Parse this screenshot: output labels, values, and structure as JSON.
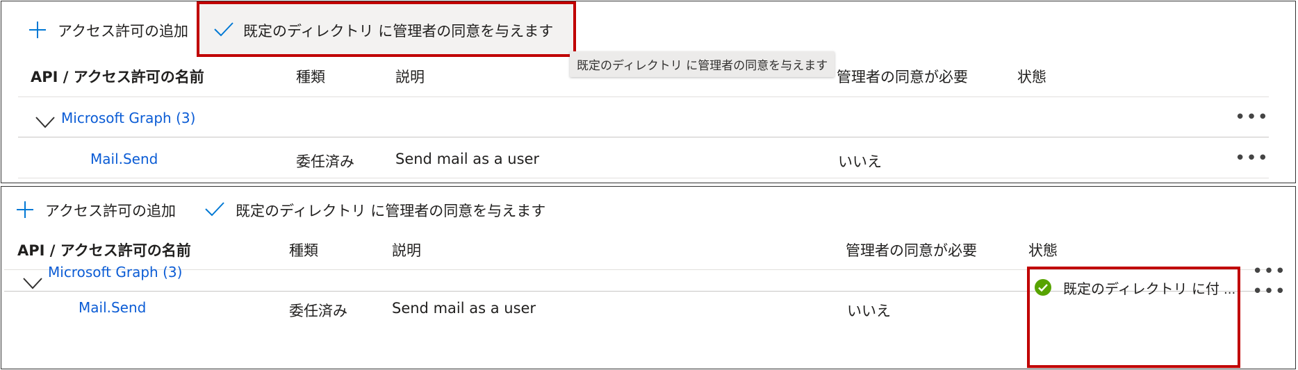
{
  "toolbar": {
    "add_permission_label": "アクセス許可の追加",
    "grant_consent_label": "既定のディレクトリ に管理者の同意を与えます"
  },
  "tooltip": {
    "text": "既定のディレクトリ に管理者の同意を与えます"
  },
  "table": {
    "headers": {
      "api_name": "API / アクセス許可の名前",
      "type": "種類",
      "description": "説明",
      "admin_consent_required": "管理者の同意が必要",
      "status": "状態"
    },
    "header_admin_consent_partial": "管理者の同意が必要",
    "group": {
      "label": "Microsoft Graph (3)"
    },
    "row": {
      "name": "Mail.Send",
      "type": "委任済み",
      "description": "Send mail as a user",
      "admin_consent": "いいえ",
      "status": "既定のディレクトリ に付"
    },
    "more_label": "•••",
    "ellipsis": "..."
  },
  "colors": {
    "highlight_border": "#c00000",
    "link": "#0b5cd5",
    "accent_icon": "#0078d4",
    "success": "#57a300"
  },
  "icons": {
    "add": "plus-icon",
    "consent": "checkmark-icon",
    "expand": "chevron-down-icon",
    "status": "check-circle-icon",
    "more": "more-icon"
  }
}
